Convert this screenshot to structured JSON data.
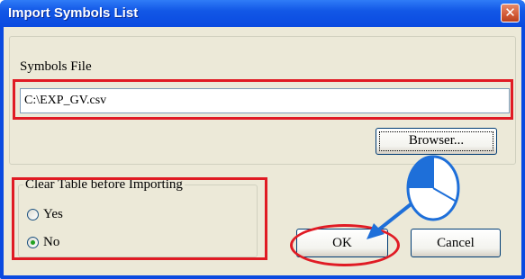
{
  "dialog": {
    "title": "Import Symbols List",
    "close_icon": "close-icon",
    "symbols_file": {
      "label": "Symbols File",
      "value": "C:\\EXP_GV.csv",
      "browse_label": "Browser..."
    },
    "clear_table": {
      "label": "Clear Table before Importing",
      "options": [
        {
          "label": "Yes",
          "selected": false
        },
        {
          "label": "No",
          "selected": true
        }
      ]
    },
    "ok_label": "OK",
    "cancel_label": "Cancel"
  },
  "annotations": {
    "highlight_color": "#e01b24",
    "arrow_color": "#1e6fd9",
    "click_icon": "mouse-left-click-icon"
  }
}
